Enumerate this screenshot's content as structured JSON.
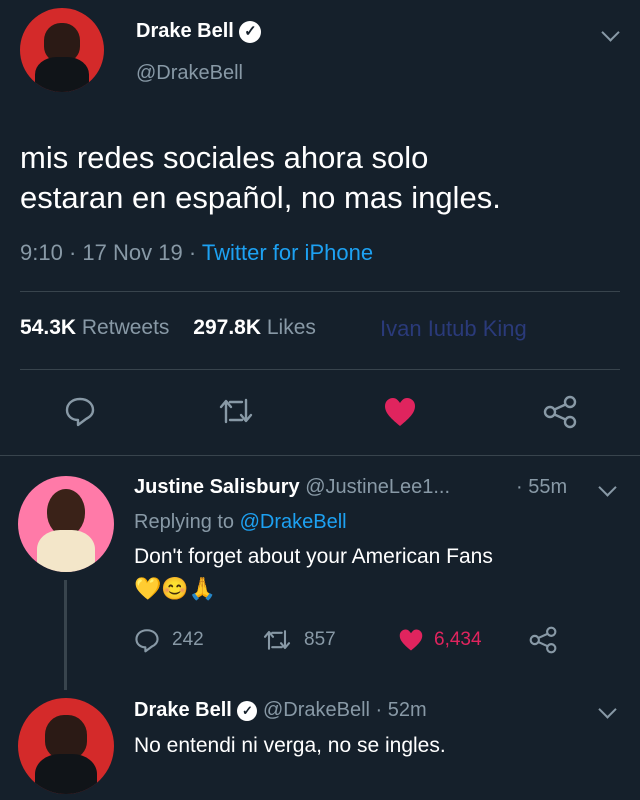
{
  "tweet": {
    "author_name": "Drake Bell",
    "author_handle": "@DrakeBell",
    "text_line1": "mis redes sociales ahora solo",
    "text_line2": "estaran en español, no mas ingles.",
    "time": "9:10",
    "date": "17 Nov 19",
    "source": "Twitter for iPhone",
    "retweets_count": "54.3K",
    "retweets_label": "Retweets",
    "likes_count": "297.8K",
    "likes_label": "Likes",
    "watermark": "Ivan Iutub King"
  },
  "reply1": {
    "author_name": "Justine Salisbury",
    "author_handle": "@JustineLee1...",
    "age": "· 55m",
    "replying_prefix": "Replying to",
    "replying_handle": "@DrakeBell",
    "text": "Don't forget about your American Fans",
    "emojis": "💛😊🙏",
    "replies": "242",
    "retweets": "857",
    "likes": "6,434"
  },
  "reply2": {
    "author_name": "Drake Bell",
    "author_handle": "@DrakeBell",
    "age": "· 52m",
    "text": "No entendi ni verga, no se ingles."
  },
  "colors": {
    "background": "#15202b",
    "accent": "#1da1f2",
    "like": "#e0245e",
    "muted": "#8899a6"
  }
}
